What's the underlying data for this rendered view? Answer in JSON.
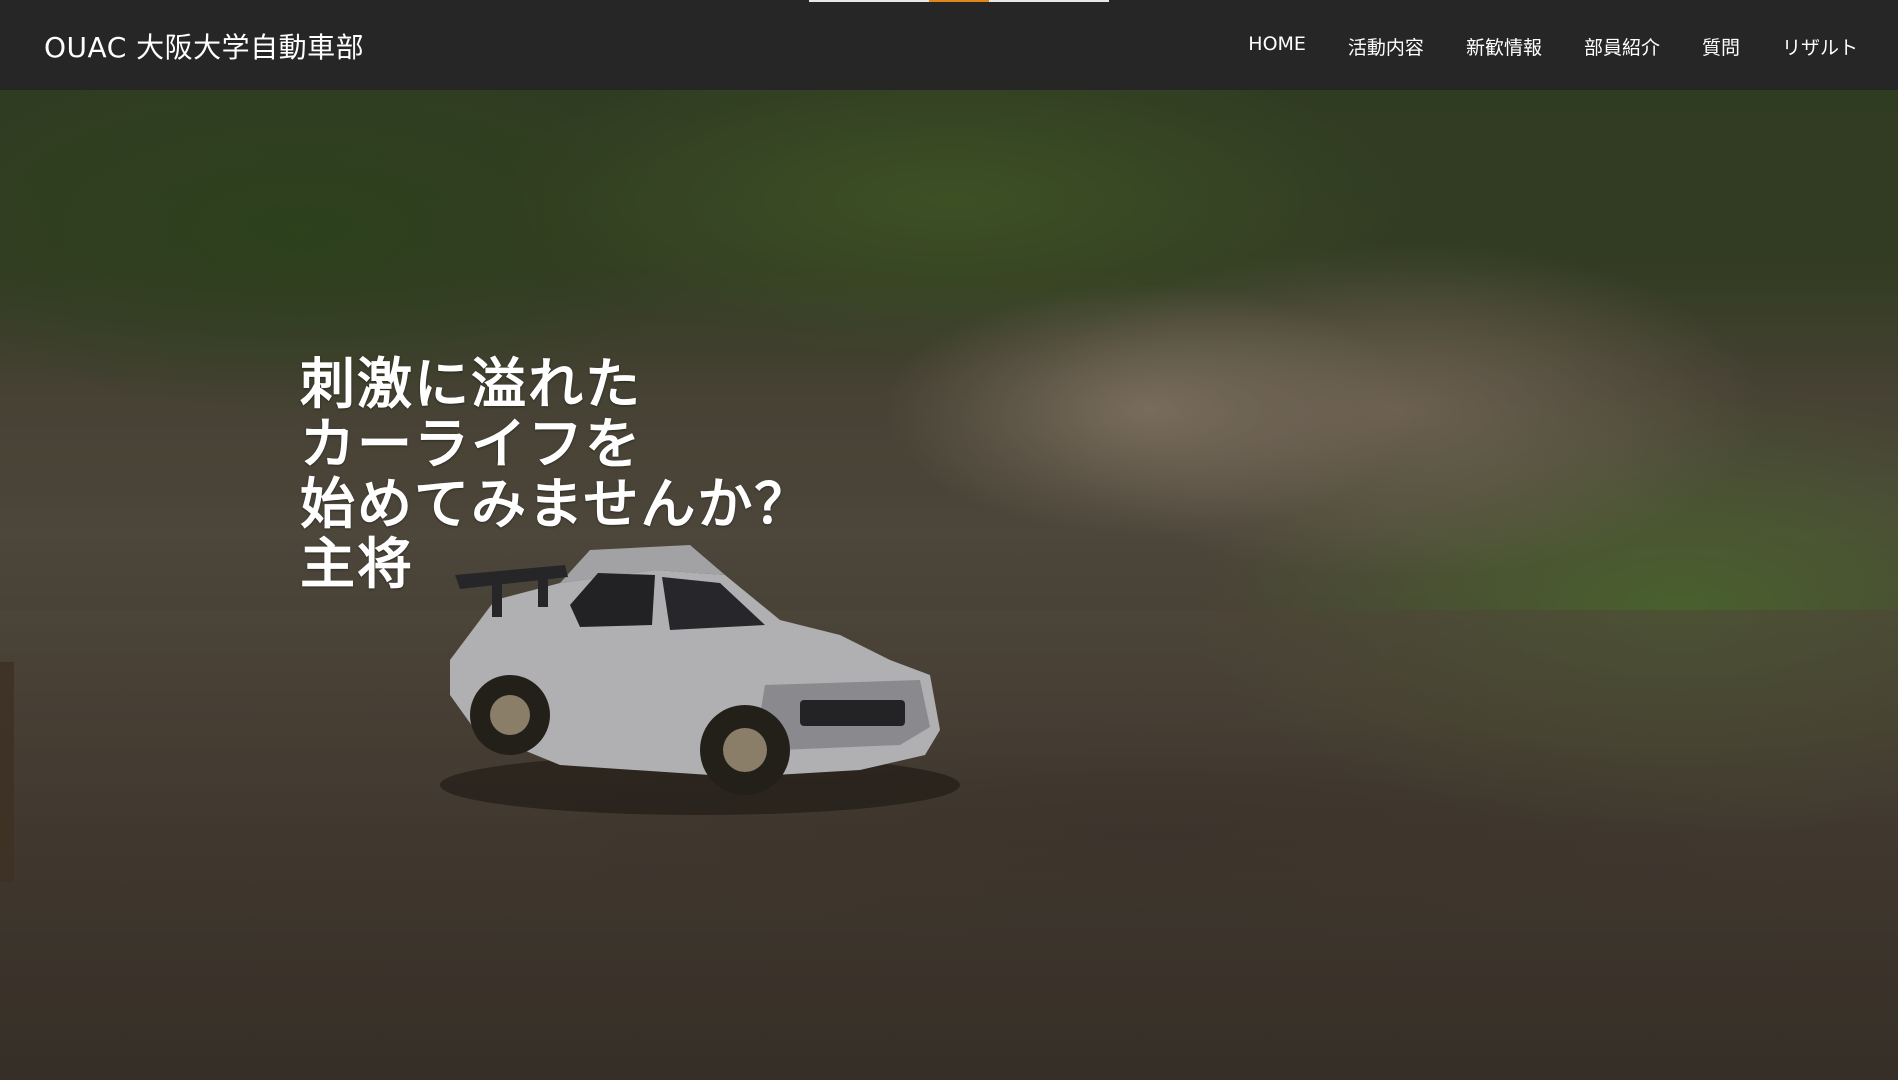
{
  "header": {
    "brand": "OUAC 大阪大学自動車部",
    "nav": [
      {
        "label": "HOME"
      },
      {
        "label": "活動内容"
      },
      {
        "label": "新歓情報"
      },
      {
        "label": "部員紹介"
      },
      {
        "label": "質問"
      },
      {
        "label": "リザルト"
      }
    ],
    "progress_fraction": 0.2
  },
  "hero": {
    "tagline_lines": [
      "刺激に溢れた",
      "カーライフを",
      "始めてみませんか？"
    ],
    "author": "主将",
    "background_description_icon": "rally-car-hero-image"
  }
}
